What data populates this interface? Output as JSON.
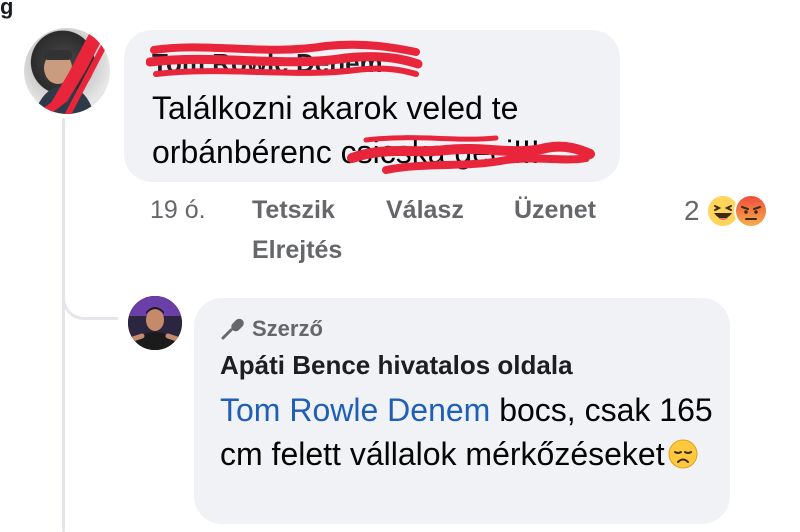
{
  "top_fragment": "g",
  "comment": {
    "author_name": "Tom Rowle Denem",
    "text_before_scribble": "Találkozni akarok veled te orbánbérenc ",
    "text_scribbled": "csicska geci!!!",
    "time": "19 ó.",
    "actions": {
      "like": "Tetszik",
      "reply": "Válasz",
      "message": "Üzenet",
      "hide": "Elrejtés"
    },
    "reaction_count": "2",
    "reaction_icons": [
      "haha-icon",
      "angry-icon"
    ]
  },
  "reply": {
    "badge": "Szerző",
    "author_name": "Apáti Bence hivatalos oldala",
    "mention": "Tom Rowle Denem",
    "text": " bocs, csak 165 cm felett vállalok mérkőzéseket",
    "emoji": "disappointed-face-icon"
  },
  "colors": {
    "bubble": "#f0f2f5",
    "mention": "#1f5fb8",
    "scribble": "#e8253a",
    "meta": "#65676b"
  }
}
